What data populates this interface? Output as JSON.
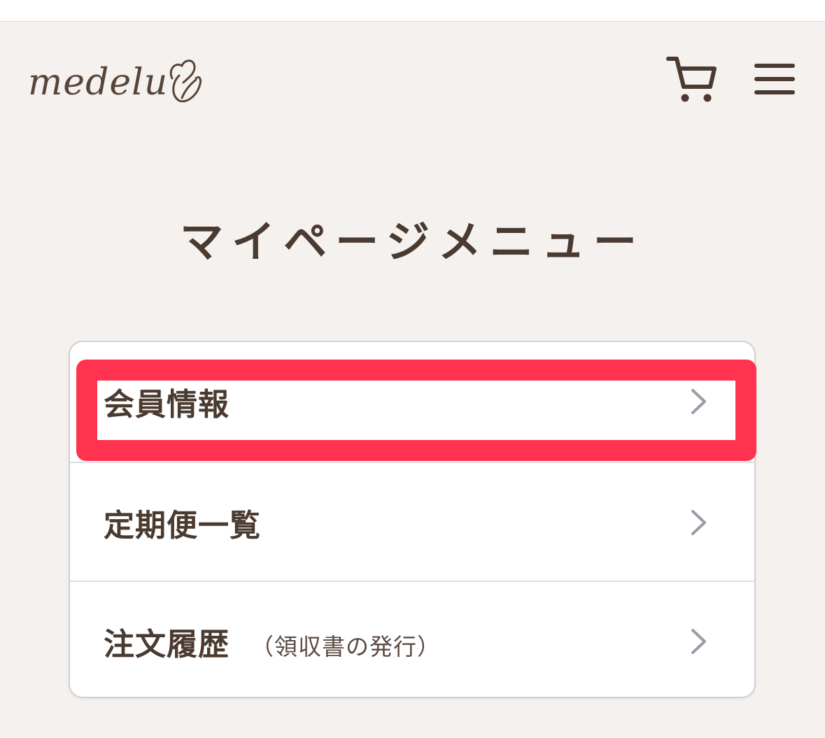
{
  "header": {
    "logo_text": "medelu",
    "cart_icon": "cart-icon",
    "menu_icon": "hamburger-menu-icon"
  },
  "page": {
    "title": "マイページメニュー"
  },
  "menu": {
    "items": [
      {
        "label": "会員情報",
        "sub": "",
        "icon": "chevron-right-icon",
        "highlighted": true
      },
      {
        "label": "定期便一覧",
        "sub": "",
        "icon": "chevron-right-icon",
        "highlighted": false
      },
      {
        "label": "注文履歴",
        "sub": "（領収書の発行）",
        "icon": "chevron-right-icon",
        "highlighted": false
      }
    ]
  },
  "colors": {
    "background": "#f5f1ef",
    "text_brown": "#4a3a30",
    "logo_brown": "#584539",
    "chevron_gray": "#9a9ca6",
    "highlight_red": "#ff334f",
    "card_border": "#cfd1d8"
  }
}
